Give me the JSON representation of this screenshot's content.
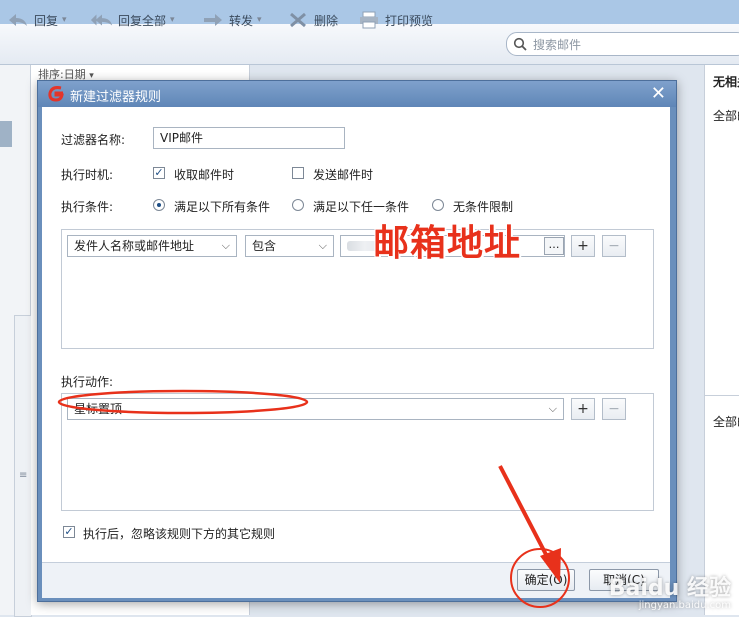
{
  "toolbar": {
    "reply": "回复",
    "reply_all": "回复全部",
    "forward": "转发",
    "delete": "删除",
    "print_preview": "打印预览",
    "search_placeholder": "搜索邮件"
  },
  "list": {
    "sort_label": "排序:日期"
  },
  "reading_pane": {
    "header": "无相关",
    "item1": "全部邮",
    "item2": "全部邮"
  },
  "dialog": {
    "title": "新建过滤器规则",
    "filter_name_label": "过滤器名称:",
    "filter_name_value": "VIP邮件",
    "timing_label": "执行时机:",
    "timing_receive": "收取邮件时",
    "timing_receive_checked": true,
    "timing_send": "发送邮件时",
    "timing_send_checked": false,
    "condition_label": "执行条件:",
    "condition_options": [
      "满足以下所有条件",
      "满足以下任一条件",
      "无条件限制"
    ],
    "condition_selected": 0,
    "condition_row": {
      "field": "发件人名称或邮件地址",
      "operator": "包含",
      "browse_button": "…",
      "add_button": "+",
      "remove_button": "−"
    },
    "action_label": "执行动作:",
    "action_row": {
      "action": "星标置顶",
      "add_button": "+",
      "remove_button": "−"
    },
    "ignore_rules_label": "执行后，忽略该规则下方的其它规则",
    "ignore_rules_checked": true,
    "ok_button": "确定(O)",
    "cancel_button": "取消(C)"
  },
  "annotation": {
    "text": "邮箱地址",
    "color": "#e8311b"
  },
  "watermark": {
    "text": "Baidu 经验",
    "sub": "jingyan.baidu.com"
  }
}
